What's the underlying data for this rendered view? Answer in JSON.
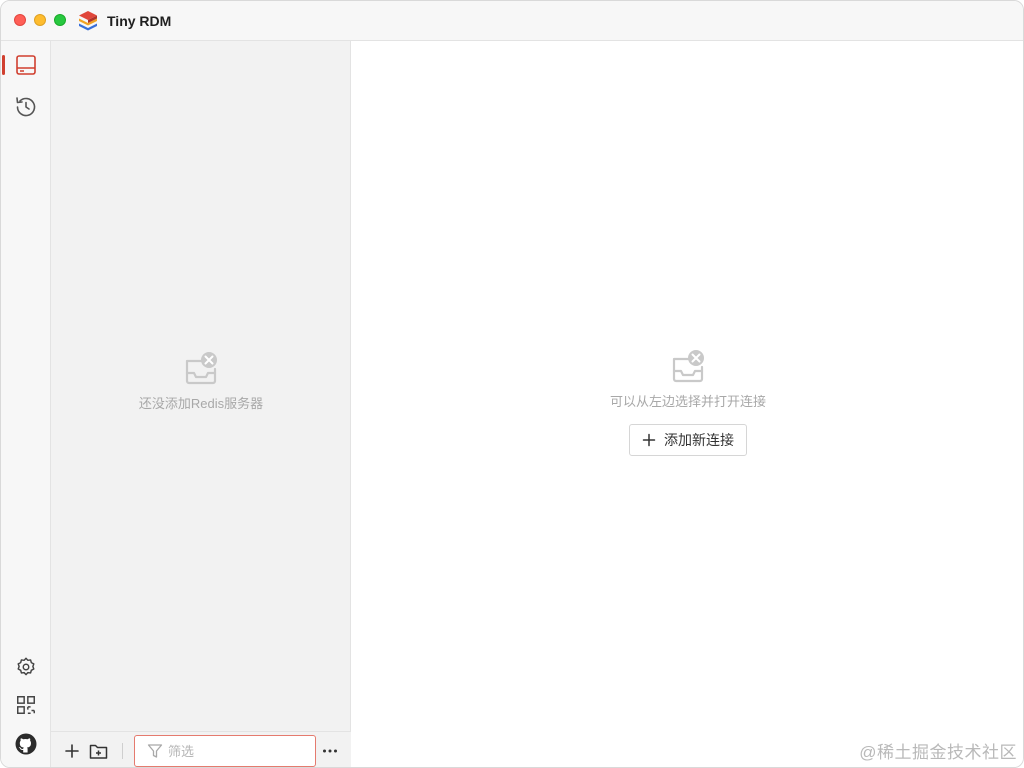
{
  "titlebar": {
    "app_title": "Tiny RDM",
    "traffic_lights": [
      "close",
      "minimize",
      "maximize"
    ]
  },
  "ribbon": {
    "top_items": [
      {
        "name": "server-icon",
        "active": true
      },
      {
        "name": "history-icon",
        "active": false
      }
    ],
    "bottom_items": [
      {
        "name": "gear-icon"
      },
      {
        "name": "apps-grid-icon"
      },
      {
        "name": "github-icon"
      }
    ],
    "accent_color": "#d03f2f"
  },
  "sidebar": {
    "empty_text": "还没添加Redis服务器",
    "footer": {
      "add_icon": "plus-icon",
      "add_group_icon": "folder-add-icon",
      "filter_placeholder": "筛选",
      "filter_value": "",
      "more_icon": "more-icon"
    }
  },
  "main": {
    "empty_text": "可以从左边选择并打开连接",
    "add_connection_label": "添加新连接"
  },
  "watermark": "@稀土掘金技术社区"
}
